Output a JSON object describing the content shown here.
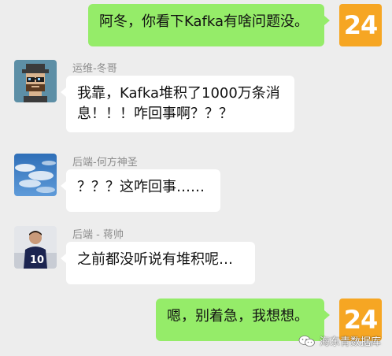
{
  "app": {
    "title": "",
    "background": "#ededed",
    "outgoing_bubble_color": "#95ec69",
    "incoming_bubble_color": "#ffffff",
    "badge_color": "#f6a623"
  },
  "messages": [
    {
      "direction": "out",
      "sender": "",
      "avatar": "badge-24",
      "badge_text": "24",
      "text": "阿冬，你看下Kafka有啥问题没。"
    },
    {
      "direction": "in",
      "sender": "运维-冬哥",
      "avatar": "pixel-hat-avatar",
      "text": "我靠，Kafka堆积了1000万条消息！！！咋回事啊？？？"
    },
    {
      "direction": "in",
      "sender": "后端-何方神圣",
      "avatar": "sky-clouds-avatar",
      "text": "？？？这咋回事……"
    },
    {
      "direction": "in",
      "sender": "后端 - 蒋帅",
      "avatar": "soccer-player-avatar",
      "text": "之前都没听说有堆积呢…"
    },
    {
      "direction": "out",
      "sender": "",
      "avatar": "badge-24",
      "badge_text": "24",
      "text": "嗯，别着急，我想想。"
    }
  ],
  "watermark": {
    "icon": "wechat-icon",
    "text": "海东青数据库"
  }
}
